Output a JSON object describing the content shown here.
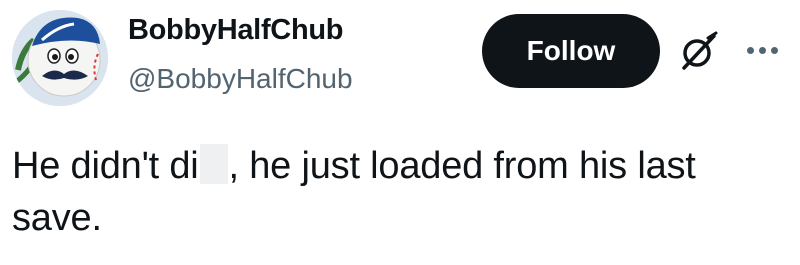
{
  "user": {
    "display_name": "BobbyHalfChub",
    "handle": "@BobbyHalfChub"
  },
  "actions": {
    "follow_label": "Follow",
    "grok_icon": "grok-icon",
    "more_icon": "more-options-icon"
  },
  "tweet": {
    "text_before_redaction": "He didn't di",
    "text_after_redaction": ", he just loaded from his last save."
  },
  "colors": {
    "text_primary": "#0f1419",
    "text_secondary": "#536471",
    "follow_button_bg": "#0f1419",
    "follow_button_text": "#ffffff"
  }
}
